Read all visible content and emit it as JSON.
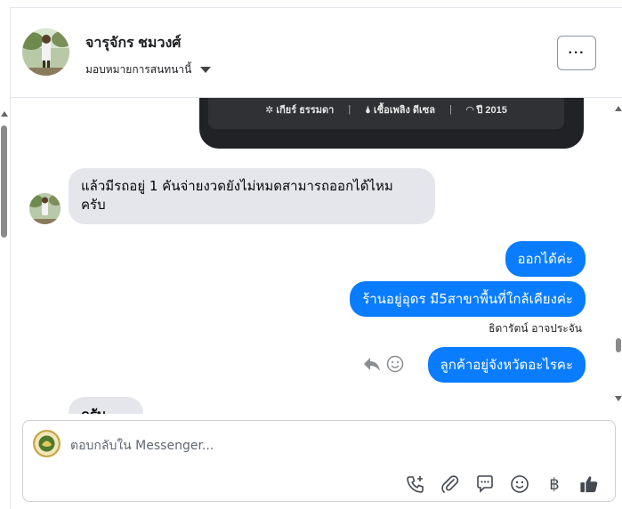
{
  "header": {
    "contact_name": "จารุจักร ชมวงศ์",
    "assign_label": "มอบหมายการสนทนานี้",
    "more_label": "···"
  },
  "thread": {
    "card": {
      "gear": "เกียร์ ธรรมดา",
      "fuel": "เชื้อเพลิง ดีเซล",
      "year": "ปี 2015",
      "separator": "|"
    },
    "messages": [
      {
        "direction": "in",
        "text_line1": "แล้วมีรถอยู่ 1 คันจ่ายงวดยังไม่หมดสามารถออกได้ไหม",
        "text_line2": "ครับ"
      },
      {
        "direction": "out",
        "text": "ออกได้ค่ะ"
      },
      {
        "direction": "out",
        "text": "ร้านอยู่อุดร มี5สาขาพื้นที่ใกล้เคียงค่ะ"
      },
      {
        "direction": "out",
        "sender": "ธิดารัตน์ อาจประจัน",
        "text": "ลูกค้าอยู่จังหวัดอะไรคะ"
      },
      {
        "direction": "in",
        "text": "ครับ"
      }
    ]
  },
  "composer": {
    "placeholder": "ตอบกลับใน Messenger..."
  },
  "colors": {
    "outgoing_bubble": "#0a7cff",
    "incoming_bubble": "#e4e6eb",
    "card_dark": "#202225"
  },
  "icons": {
    "more": "more-horizontal-icon",
    "reply": "reply-icon",
    "react": "emoji-icon",
    "tools": [
      "call-add-icon",
      "paperclip-icon",
      "saved-reply-icon",
      "emoji-icon",
      "baht-icon",
      "thumbs-up-icon"
    ]
  }
}
